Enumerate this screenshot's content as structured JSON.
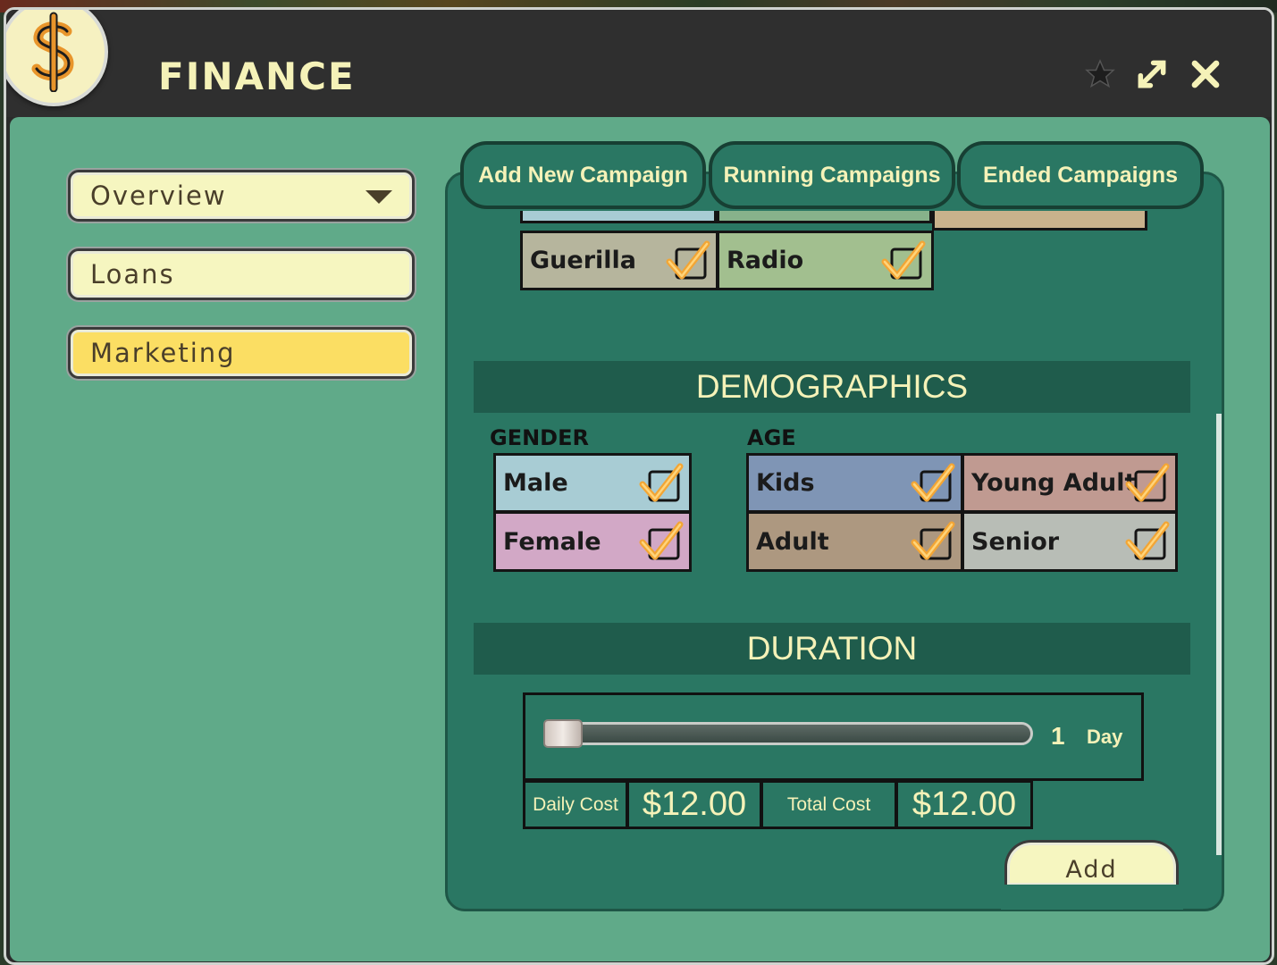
{
  "window": {
    "title": "FINANCE"
  },
  "sidebar": {
    "items": [
      {
        "label": "Overview",
        "type": "dropdown"
      },
      {
        "label": "Loans"
      },
      {
        "label": "Marketing",
        "active": true
      }
    ]
  },
  "tabs": [
    "Add New Campaign",
    "Running Campaigns",
    "Ended Campaigns"
  ],
  "media": {
    "items": [
      {
        "label": "Guerilla",
        "checked": true,
        "color": "#b6b59d"
      },
      {
        "label": "Radio",
        "checked": true,
        "color": "#a2bf8f"
      }
    ]
  },
  "demographics": {
    "heading": "DEMOGRAPHICS",
    "gender_label": "GENDER",
    "age_label": "AGE",
    "gender": [
      {
        "label": "Male",
        "checked": true,
        "color": "#a8ccd4"
      },
      {
        "label": "Female",
        "checked": true,
        "color": "#d2a8c6"
      }
    ],
    "age": [
      {
        "label": "Kids",
        "checked": true,
        "color": "#7f95b5"
      },
      {
        "label": "Young Adult",
        "checked": true,
        "color": "#c09a91"
      },
      {
        "label": "Adult",
        "checked": true,
        "color": "#ad9880"
      },
      {
        "label": "Senior",
        "checked": true,
        "color": "#b8bdb6"
      }
    ]
  },
  "duration": {
    "heading": "DURATION",
    "value": "1",
    "unit": "Day",
    "daily_cost_label": "Daily Cost",
    "daily_cost": "$12.00",
    "total_cost_label": "Total Cost",
    "total_cost": "$12.00"
  },
  "actions": {
    "add_label": "Add"
  }
}
